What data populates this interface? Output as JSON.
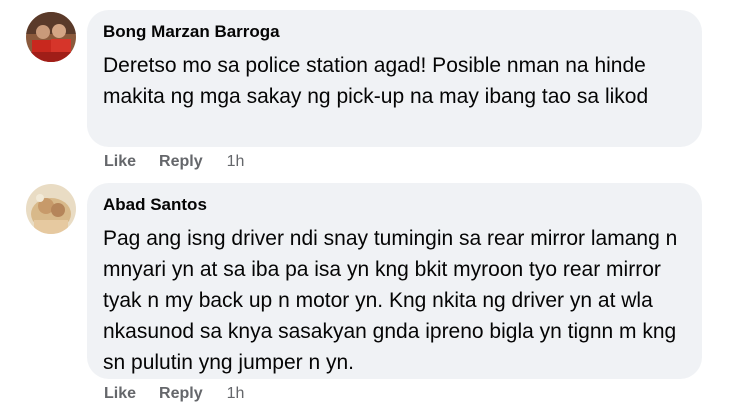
{
  "comments": [
    {
      "author": "Bong Marzan Barroga",
      "text": "Deretso mo sa police station agad! Posible nman na hinde makita ng mga sakay ng pick-up na may ibang tao sa likod",
      "like_label": "Like",
      "reply_label": "Reply",
      "timestamp": "1h"
    },
    {
      "author": "Abad Santos",
      "text": "Pag ang isng driver ndi snay tumingin sa rear mirror lamang n mnyari yn at sa iba pa isa yn kng bkit myroon tyo rear mirror tyak n my back up n motor yn. Kng nkita ng driver yn at wla nkasunod sa knya sasakyan gnda ipreno bigla yn tignn m kng sn pulutin yng jumper n yn.",
      "like_label": "Like",
      "reply_label": "Reply",
      "timestamp": "1h"
    }
  ],
  "colors": {
    "bubble_bg": "#f0f2f5",
    "text": "#050505",
    "secondary": "#65676b"
  }
}
